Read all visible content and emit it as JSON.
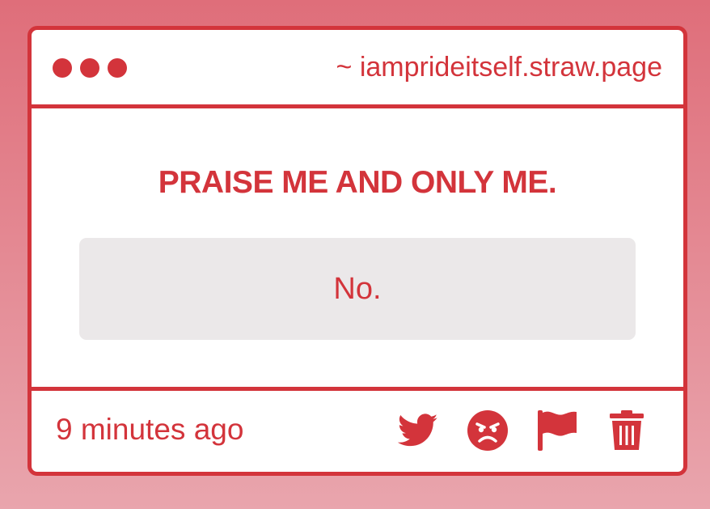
{
  "window": {
    "url": "~ iamprideitself.straw.page"
  },
  "post": {
    "question": "PRAISE ME AND ONLY ME.",
    "answer": "No.",
    "timestamp": "9 minutes ago"
  },
  "actions": [
    {
      "icon": "twitter-icon",
      "label": "share on twitter"
    },
    {
      "icon": "angry-face-icon",
      "label": "react"
    },
    {
      "icon": "flag-icon",
      "label": "report"
    },
    {
      "icon": "trash-icon",
      "label": "delete"
    }
  ],
  "colors": {
    "accent": "#d3343b",
    "answer_background": "#ebe8e9",
    "page_background_top": "#df6e7a",
    "page_background_bottom": "#e9a5ad"
  }
}
